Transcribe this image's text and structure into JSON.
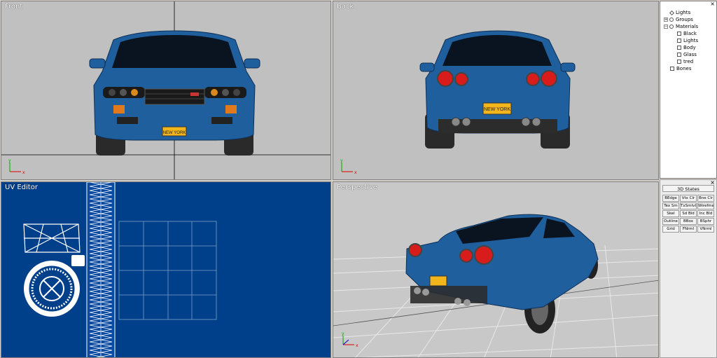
{
  "viewports": {
    "front": {
      "title": "Front",
      "plate": "NEW YORK"
    },
    "back": {
      "title": "Back",
      "plate": "NEW YORK"
    },
    "uv": {
      "title": "UV Editor"
    },
    "perspective": {
      "title": "Perspective"
    }
  },
  "axis": {
    "x": "x",
    "y": "y"
  },
  "scene_tree": {
    "close": "×",
    "items": [
      {
        "label": "Lights",
        "expander": "",
        "icon": "diamond-icon"
      },
      {
        "label": "Groups",
        "expander": "+",
        "icon": "group-icon"
      },
      {
        "label": "Materials",
        "expander": "−",
        "icon": "material-sphere-icon"
      },
      {
        "label": "Black",
        "expander": "",
        "icon": "material-swatch-icon"
      },
      {
        "label": "Lights",
        "expander": "",
        "icon": "material-swatch-icon"
      },
      {
        "label": "Body",
        "expander": "",
        "icon": "material-swatch-icon"
      },
      {
        "label": "Glass",
        "expander": "",
        "icon": "material-swatch-icon"
      },
      {
        "label": "tred",
        "expander": "",
        "icon": "material-swatch-icon"
      },
      {
        "label": "Bones",
        "expander": "",
        "icon": "bone-icon"
      }
    ]
  },
  "states_panel": {
    "close": "×",
    "title": "3D States",
    "buttons": [
      "BEdge",
      "Vtx Clr",
      "Bne Clr",
      "Tex Sm",
      "TxSmIvIr",
      "Wirefme",
      "Skel",
      "Sd Bld",
      "Inc Bld",
      "Outline",
      "BBox",
      "BSphr",
      "Grid",
      "FNrml",
      "VNrml"
    ]
  },
  "colors": {
    "viewport_bg": "#c0c0c0",
    "uv_bg": "#003f8a",
    "car_blue": "#1f5f9e",
    "plate_yellow": "#f2b51c",
    "taillight_red": "#d81c1c"
  }
}
